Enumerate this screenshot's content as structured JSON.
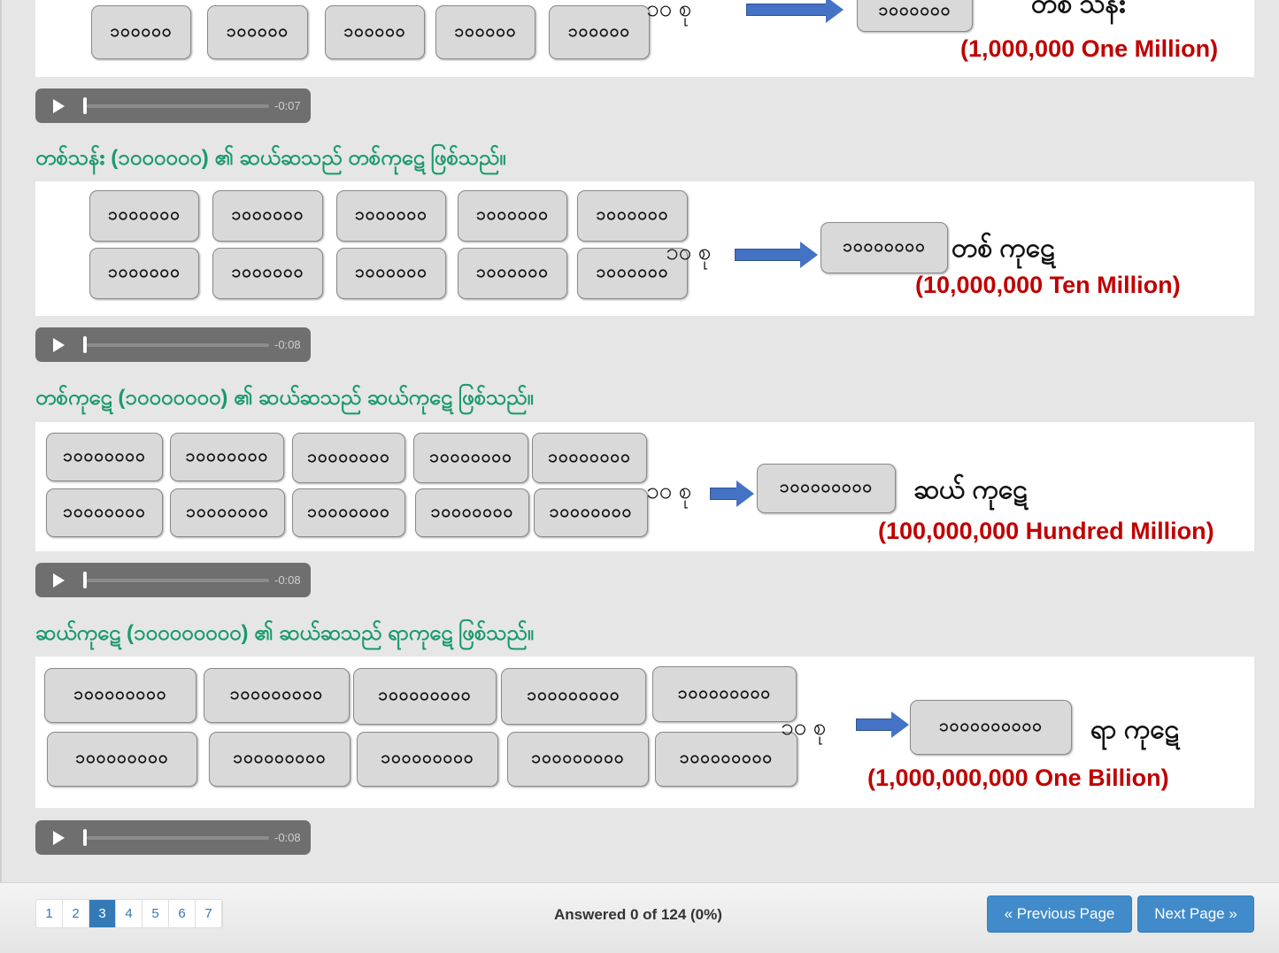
{
  "sections": [
    {
      "boxes_value": "၁၀၀၀၀၀",
      "result_value": "၁၀၀၀၀၀၀",
      "group_label": "၁၀ စု",
      "mm_label": "တစ် သန်း",
      "en_label": "(1,000,000 One Million)",
      "audio_time": "-0:07"
    },
    {
      "heading": "တစ်သန်း (၁၀၀၀၀၀၀) ၏ ဆယ်ဆသည် တစ်ကုဋေ ဖြစ်သည်။",
      "boxes_value": "၁၀၀၀၀၀၀",
      "result_value": "၁၀၀၀၀၀၀၀",
      "group_label": "၁၀ စု",
      "mm_label": "တစ် ကုဋေ",
      "en_label": "(10,000,000 Ten Million)",
      "audio_time": "-0:08"
    },
    {
      "heading": "တစ်ကုဋေ (၁၀၀၀၀၀၀၀) ၏ ဆယ်ဆသည် ဆယ်ကုဋေ ဖြစ်သည်။",
      "boxes_value": "၁၀၀၀၀၀၀၀",
      "result_value": "၁၀၀၀၀၀၀၀၀",
      "group_label": "၁၀ စု",
      "mm_label": "ဆယ် ကုဋေ",
      "en_label": "(100,000,000 Hundred Million)",
      "audio_time": "-0:08"
    },
    {
      "heading": "ဆယ်ကုဋေ (၁၀၀၀၀၀၀၀၀) ၏ ဆယ်ဆသည် ရာကုဋေ ဖြစ်သည်။",
      "boxes_value": "၁၀၀၀၀၀၀၀၀",
      "result_value": "၁၀၀၀၀၀၀၀၀၀",
      "group_label": "၁၀ စု",
      "mm_label": "ရာ ကုဋေ",
      "en_label": "(1,000,000,000 One Billion)",
      "audio_time": "-0:08"
    }
  ],
  "footer": {
    "pages": [
      "1",
      "2",
      "3",
      "4",
      "5",
      "6",
      "7"
    ],
    "current_page": "3",
    "answered": "Answered 0 of 124 (0%)",
    "prev_label": "« Previous Page",
    "next_label": "Next Page »"
  },
  "colors": {
    "heading": "#1a9a6c",
    "english_label": "#c00000",
    "arrow": "#4472c4",
    "button": "#428bca"
  }
}
